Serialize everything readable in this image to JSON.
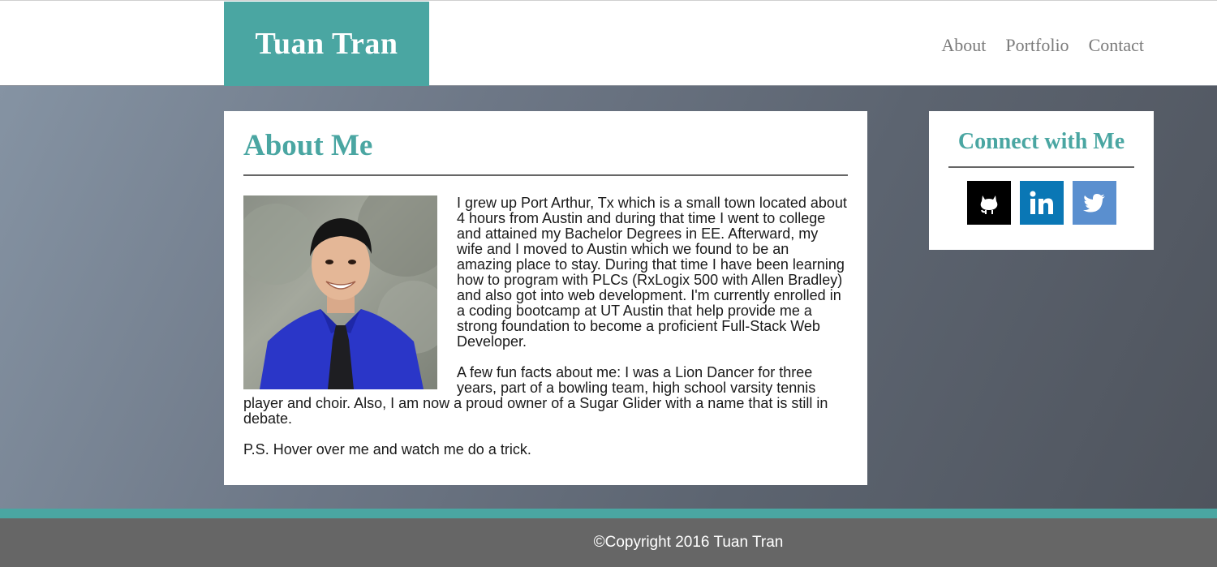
{
  "header": {
    "brand": "Tuan Tran",
    "nav": [
      {
        "label": "About"
      },
      {
        "label": "Portfolio"
      },
      {
        "label": "Contact"
      }
    ]
  },
  "about": {
    "title": "About Me",
    "paragraphs": [
      "I grew up Port Arthur, Tx which is a small town located about 4 hours from Austin and during that time I went to college and attained my Bachelor Degrees in EE. Afterward, my wife and I moved to Austin which we found to be an amazing place to stay. During that time I have been learning how to program with PLCs (RxLogix 500 with Allen Bradley) and also got into web development. I'm currently enrolled in a coding bootcamp at UT Austin that help provide me a strong foundation to become a proficient Full-Stack Web Developer.",
      "A few fun facts about me: I was a Lion Dancer for three years, part of a bowling team, high school varsity tennis player and choir. Also, I am now a proud owner of a Sugar Glider with a name that is still in debate.",
      "P.S. Hover over me and watch me do a trick."
    ]
  },
  "connect": {
    "title": "Connect with Me",
    "icons": [
      {
        "name": "github-icon",
        "color": "#000000"
      },
      {
        "name": "linkedin-icon",
        "color": "#0a77b5"
      },
      {
        "name": "twitter-icon",
        "color": "#5a8fcf"
      }
    ]
  },
  "footer": {
    "copyright": "©Copyright 2016 Tuan Tran"
  },
  "colors": {
    "accent": "#4aa6a2",
    "footer": "#666666"
  }
}
